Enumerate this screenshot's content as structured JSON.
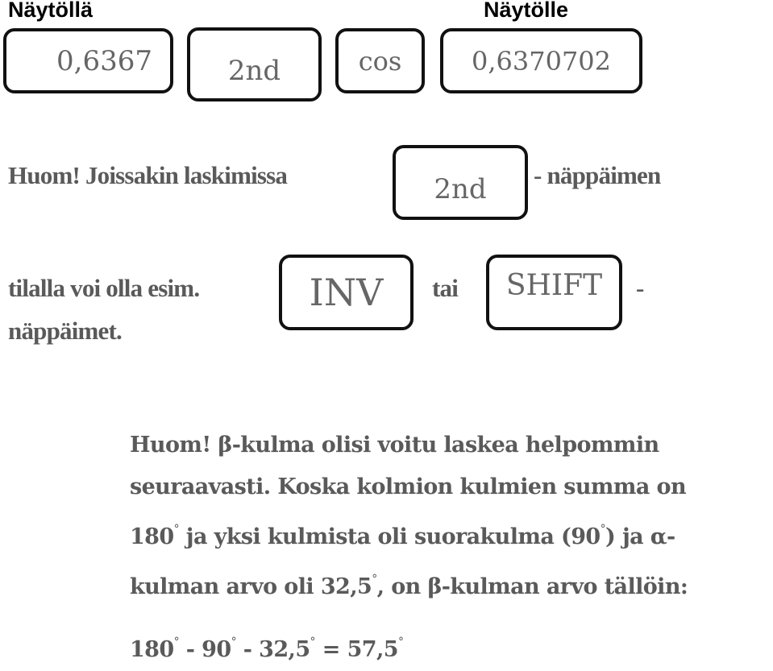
{
  "headings": {
    "on_screen": "Näytöllä",
    "to_screen": "Näytölle"
  },
  "keys": {
    "display_value": "0,6367",
    "second_key": "2nd",
    "cos_key": "cos",
    "result_value": "0,6370702",
    "second_key_note": "2nd",
    "inv_key": "INV",
    "shift_key": "SHIFT"
  },
  "note1": {
    "line1_before": "Huom! Joissakin laskimissa",
    "line1_after": "- näppäimen",
    "line2_before": "tilalla voi olla esim.",
    "line2_mid": "tai",
    "line2_after": "-",
    "line3": "näppäimet."
  },
  "note2": {
    "lines": [
      "Huom! β-kulma olisi voitu laskea helpommin",
      "seuraavasti. Koska kolmion kulmien summa on"
    ],
    "line3_parts": [
      "180",
      " ja yksi kulmista oli suorakulma (90",
      ") ja α-"
    ],
    "line4_parts": [
      "kulman arvo oli 32,5",
      ", on β-kulman arvo tällöin:"
    ],
    "equation_parts": [
      "180",
      " - 90",
      " - 32,5",
      " = 57,5"
    ],
    "degree": "°"
  }
}
